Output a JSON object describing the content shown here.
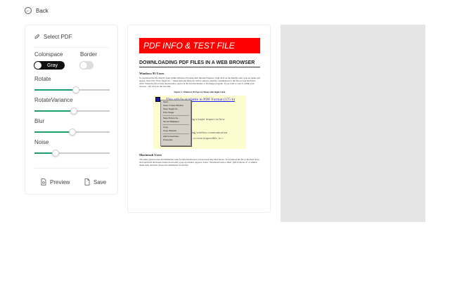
{
  "nav": {
    "back_label": "Back"
  },
  "panel": {
    "select_pdf_label": "Select PDF",
    "colorspace_label": "Colorspace",
    "colorspace_value": "Gray",
    "border_label": "Border",
    "border_enabled": false,
    "sliders": [
      {
        "label": "Rotate",
        "value": 0.55
      },
      {
        "label": "RotateVariance",
        "value": 0.52
      },
      {
        "label": "Blur",
        "value": 0.5
      },
      {
        "label": "Noise",
        "value": 0.28
      }
    ],
    "preview_label": "Preview",
    "save_label": "Save",
    "accent_color": "#1e9e6a"
  },
  "document": {
    "banner": "PDF INFO & TEST FILE",
    "heading": "DOWNLOADING PDF FILES IN A WEB BROWSER",
    "section1_title": "Windows 95 Users",
    "section1_text": "To download the file directly from within Windows 95 using their Internet Explorer, right click on the link/file and a pop-up menu will appear. Select the \"Save Target As...\" menu item and then you will be asked to identify a destination for the file on your hard hard drive. When the file is fully downloaded, open it in the Acrobat Reader or Exchange program. If you want to view it within your browser - left click on the text link.",
    "figure_caption": "Figure 1. Windows 95 Pop-Up Menu with Right Click",
    "shot_link": "This article available in PDF Format (175 k)",
    "shot_line1": "ting a major impact on how",
    "shot_line2": "s)",
    "shot_line3": "iling wireless communication",
    "shot_line4": "h, or even impossible, to c",
    "menu_items": [
      "Open",
      "Open in New Window",
      "Save Target As...",
      "Print Target",
      "Save Picture As...",
      "Set as Wallpaper",
      "Copy",
      "Copy Shortcut",
      "Add to Favorites...",
      "Properties"
    ],
    "section2_title": "Macintosh Users",
    "section2_text": "The same general rules and limitations exist for Macintosh users as have been described above. To download the file to the hard drive, click and hold the mouse button down until a pop-up window appears. Select \"Download Link to Disk\" (MS Explorer 4+ or similar menu item, and then choose the destination for the file."
  }
}
